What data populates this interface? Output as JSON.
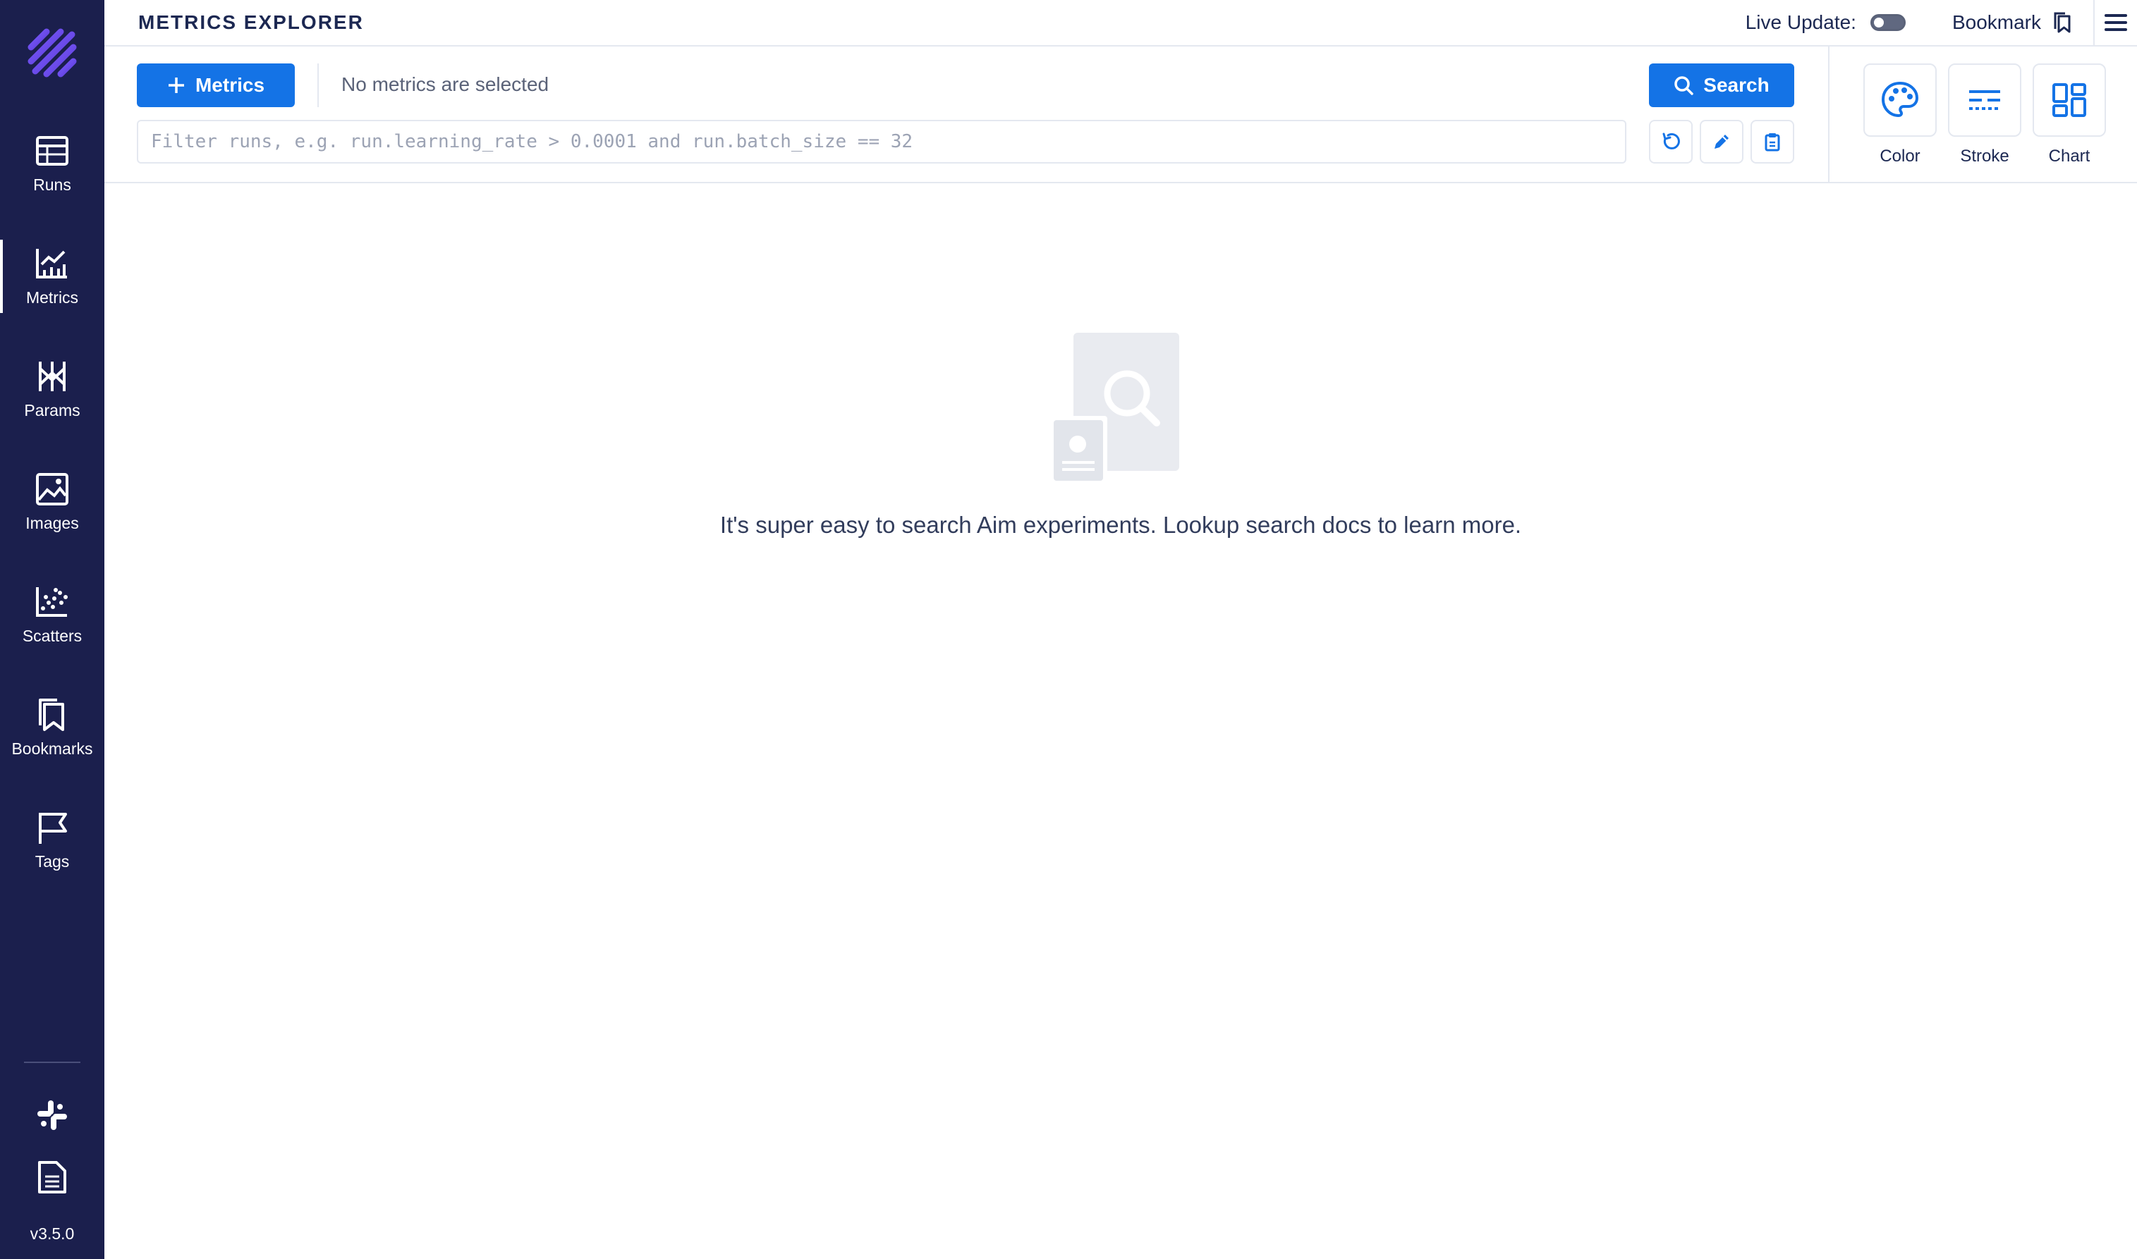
{
  "sidebar": {
    "logo_icon": "aim-logo-icon",
    "items": [
      {
        "label": "Runs",
        "icon": "table-icon",
        "active": false
      },
      {
        "label": "Metrics",
        "icon": "line-chart-icon",
        "active": true
      },
      {
        "label": "Params",
        "icon": "params-icon",
        "active": false
      },
      {
        "label": "Images",
        "icon": "image-icon",
        "active": false
      },
      {
        "label": "Scatters",
        "icon": "scatter-icon",
        "active": false
      },
      {
        "label": "Bookmarks",
        "icon": "bookmarks-icon",
        "active": false
      },
      {
        "label": "Tags",
        "icon": "flag-icon",
        "active": false
      }
    ],
    "bottom_icons": [
      "slack-icon",
      "docs-icon"
    ],
    "version": "v3.5.0"
  },
  "header": {
    "title": "METRICS EXPLORER",
    "live_update_label": "Live Update:",
    "live_update_on": false,
    "bookmark_label": "Bookmark"
  },
  "toolbar": {
    "metrics_button_label": "Metrics",
    "no_metrics_text": "No metrics are selected",
    "search_button_label": "Search",
    "filter_placeholder": "Filter runs, e.g. run.learning_rate > 0.0001 and run.batch_size == 32",
    "filter_value": "",
    "controls": [
      {
        "label": "Color",
        "icon": "palette-icon"
      },
      {
        "label": "Stroke",
        "icon": "stroke-style-icon"
      },
      {
        "label": "Chart",
        "icon": "chart-grid-icon"
      }
    ]
  },
  "empty_state": {
    "message": "It's super easy to search Aim experiments. Lookup search docs to learn more."
  },
  "colors": {
    "sidebar_bg": "#1b1f4d",
    "primary": "#1473e6",
    "text": "#1c2852",
    "border": "#e4e8f0"
  }
}
